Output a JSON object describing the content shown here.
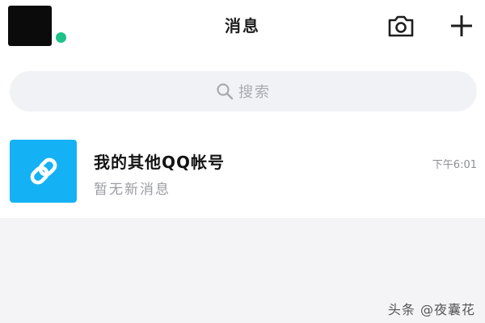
{
  "header": {
    "title": "消息",
    "camera_icon": "camera-icon",
    "add_icon": "plus-icon"
  },
  "search": {
    "placeholder": "搜索",
    "icon": "search-icon"
  },
  "chats": [
    {
      "name": "我的其他QQ帐号",
      "preview": "暂无新消息",
      "time": "下午6:01",
      "icon": "link-icon",
      "icon_bg": "#14b2f4"
    }
  ],
  "status": {
    "online_color": "#1ec186"
  },
  "watermark": "头条 @夜囊花"
}
